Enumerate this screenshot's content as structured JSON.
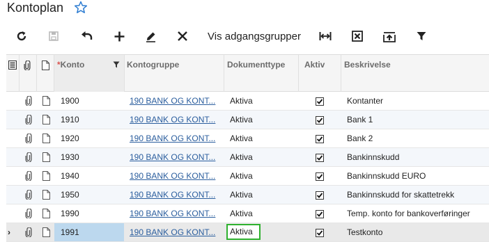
{
  "page": {
    "title": "Kontoplan"
  },
  "toolbar": {
    "access_groups_label": "Vis adgangsgrupper"
  },
  "table": {
    "headers": {
      "required_marker": "*",
      "konto": "Konto",
      "kontogruppe": "Kontogruppe",
      "dokumenttype": "Dokumenttype",
      "aktiv": "Aktiv",
      "beskrivelse": "Beskrivelse"
    },
    "rows": [
      {
        "konto": "1900",
        "kontogruppe": "190 BANK OG KONT...",
        "dokumenttype": "Aktiva",
        "aktiv": true,
        "beskrivelse": "Kontanter"
      },
      {
        "konto": "1910",
        "kontogruppe": "190 BANK OG KONT...",
        "dokumenttype": "Aktiva",
        "aktiv": true,
        "beskrivelse": "Bank 1"
      },
      {
        "konto": "1920",
        "kontogruppe": "190 BANK OG KONT...",
        "dokumenttype": "Aktiva",
        "aktiv": true,
        "beskrivelse": "Bank 2"
      },
      {
        "konto": "1930",
        "kontogruppe": "190 BANK OG KONT...",
        "dokumenttype": "Aktiva",
        "aktiv": true,
        "beskrivelse": "Bankinnskudd"
      },
      {
        "konto": "1940",
        "kontogruppe": "190 BANK OG KONT...",
        "dokumenttype": "Aktiva",
        "aktiv": true,
        "beskrivelse": "Bankinnskudd EURO"
      },
      {
        "konto": "1950",
        "kontogruppe": "190 BANK OG KONT...",
        "dokumenttype": "Aktiva",
        "aktiv": true,
        "beskrivelse": "Bankinnskudd for skattetrekk"
      },
      {
        "konto": "1990",
        "kontogruppe": "190 BANK OG KONT...",
        "dokumenttype": "Aktiva",
        "aktiv": true,
        "beskrivelse": "Temp. konto for bankoverføringer"
      },
      {
        "konto": "1991",
        "kontogruppe": "190 BANK OG KONT...",
        "dokumenttype": "Aktiva",
        "aktiv": true,
        "beskrivelse": "Testkonto"
      }
    ]
  },
  "icons": {
    "favorite": "star-icon",
    "refresh": "refresh-icon",
    "save": "save-icon",
    "undo": "undo-icon",
    "add": "plus-icon",
    "edit": "pencil-icon",
    "delete": "close-icon",
    "fit": "fit-columns-icon",
    "excel": "excel-export-icon",
    "upload": "upload-icon",
    "filter": "filter-icon"
  },
  "colors": {
    "link": "#2b5e9e",
    "selected_cell": "#bcd8ee",
    "edit_border": "#2fb12f",
    "star": "#2b7bd1"
  }
}
